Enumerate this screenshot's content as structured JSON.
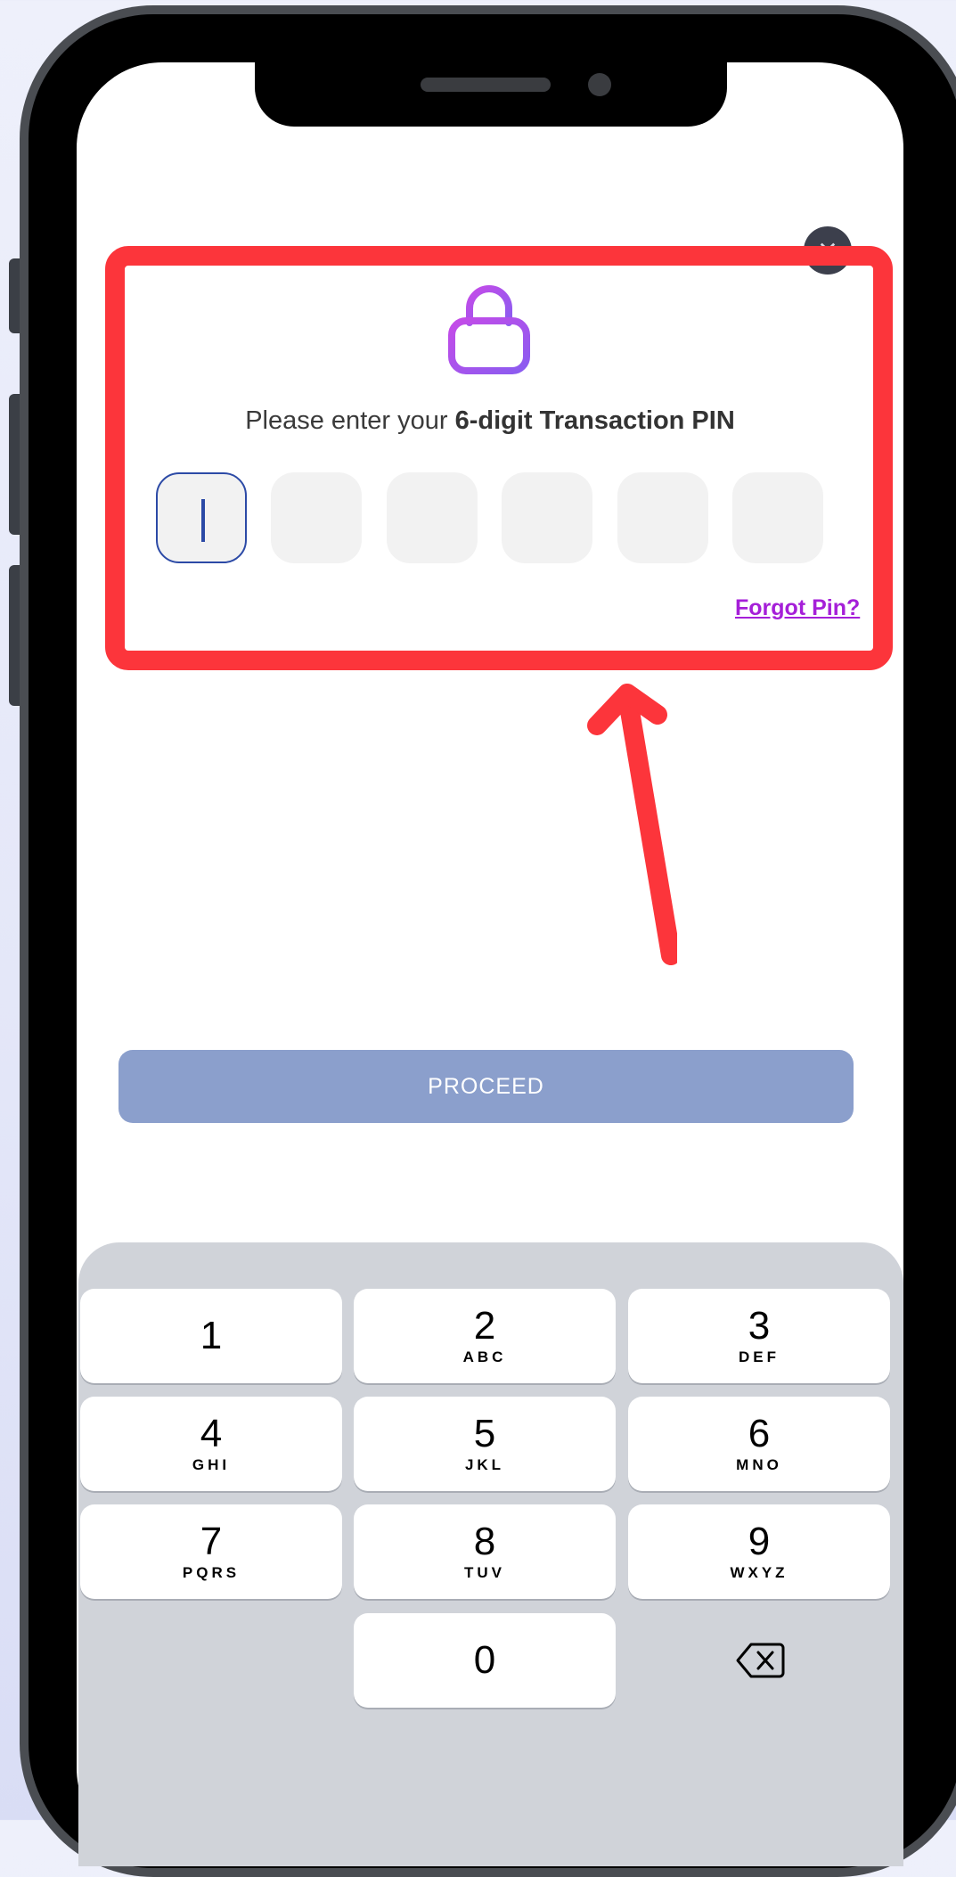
{
  "header": {
    "close_icon": "close-icon"
  },
  "pin_prompt": {
    "lock_icon": "lock-icon",
    "text_plain": "Please enter your ",
    "text_bold": "6-digit Transaction PIN",
    "digits": 6,
    "forgot_link": "Forgot Pin?"
  },
  "proceed_button": "PROCEED",
  "keypad": {
    "keys": [
      {
        "num": "1",
        "letters": ""
      },
      {
        "num": "2",
        "letters": "ABC"
      },
      {
        "num": "3",
        "letters": "DEF"
      },
      {
        "num": "4",
        "letters": "GHI"
      },
      {
        "num": "5",
        "letters": "JKL"
      },
      {
        "num": "6",
        "letters": "MNO"
      },
      {
        "num": "7",
        "letters": "PQRS"
      },
      {
        "num": "8",
        "letters": "TUV"
      },
      {
        "num": "9",
        "letters": "WXYZ"
      },
      {
        "num": "0",
        "letters": ""
      }
    ],
    "backspace_icon": "backspace-icon"
  },
  "colors": {
    "highlight": "#fc353b",
    "accent_purple": "#a51fd8",
    "proceed_bg": "#8b9fcc",
    "active_pin_border": "#2c4aa6"
  }
}
